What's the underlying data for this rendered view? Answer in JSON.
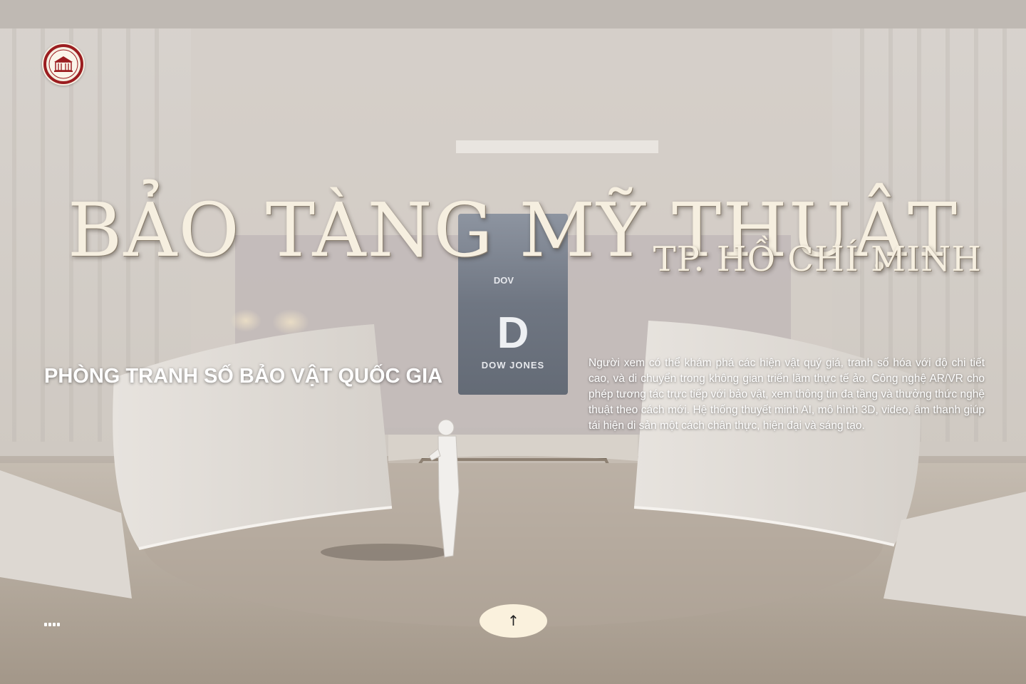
{
  "header": {
    "logo_text": "BẢO TÀNG MỸ THUẬT"
  },
  "hero": {
    "title": "BẢO TÀNG MỸ THUẬT",
    "subtitle": "TP. HỒ CHÍ MINH"
  },
  "section": {
    "heading": "PHÒNG TRANH SỐ BẢO VẬT QUỐC GIA",
    "description": "Người xem có thể khám phá các hiện vật quý giá, tranh số hóa với độ chi tiết cao, và di chuyển trong không gian triển lãm thực tế ảo. Công nghệ AR/VR cho phép tương tác trực tiếp với bảo vật, xem thông tin đa tầng và thưởng thức nghệ thuật theo cách mới. Hệ thống thuyết minh AI, mô hình 3D, video, âm thanh giúp tái hiện di sản một cách chân thực, hiện đại và sáng tạo."
  },
  "backdrop": {
    "screen_top_text": "DOV",
    "screen_logo_letter": "D",
    "screen_bottom_text": "DOW JONES"
  },
  "controls": {
    "scroll_up_icon": "↑"
  },
  "colors": {
    "title": "#f6efe0",
    "button_bg": "#faf1dd",
    "logo_red": "#9b1d20"
  }
}
